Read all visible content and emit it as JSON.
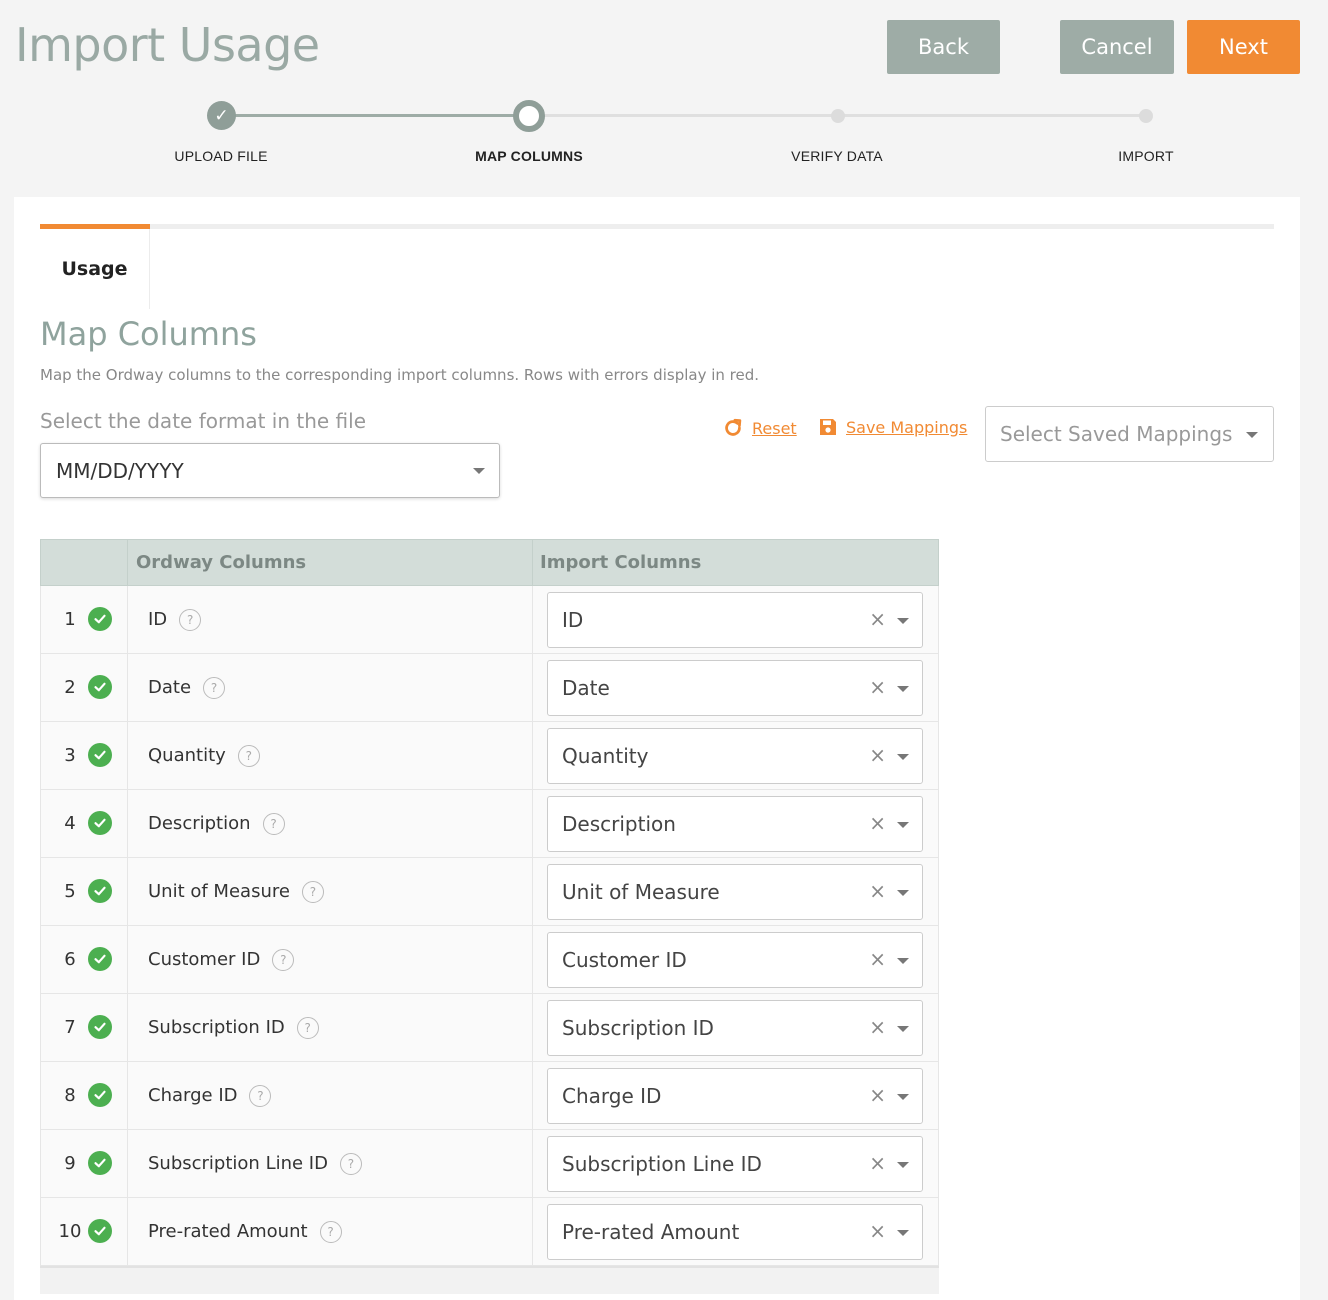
{
  "header": {
    "title": "Import Usage",
    "back_label": "Back",
    "cancel_label": "Cancel",
    "next_label": "Next"
  },
  "colors": {
    "accent": "#f18a33",
    "muted_button": "#9eaca6",
    "success": "#4caf50",
    "table_header": "#d3ddd9"
  },
  "stepper": {
    "steps": [
      {
        "label": "UPLOAD FILE",
        "state": "done"
      },
      {
        "label": "MAP COLUMNS",
        "state": "current"
      },
      {
        "label": "VERIFY DATA",
        "state": "todo"
      },
      {
        "label": "IMPORT",
        "state": "todo"
      }
    ]
  },
  "tabs": [
    {
      "label": "Usage",
      "active": true
    }
  ],
  "main": {
    "title": "Map Columns",
    "description": "Map the Ordway columns to the corresponding import columns. Rows with errors display in red.",
    "date_format_label": "Select the date format in the file",
    "date_format_value": "MM/DD/YYYY",
    "reset_label": "Reset",
    "save_mappings_label": "Save Mappings",
    "saved_mappings_placeholder": "Select Saved Mappings"
  },
  "table": {
    "headers": {
      "col1": "",
      "ordway": "Ordway Columns",
      "import": "Import Columns"
    },
    "rows": [
      {
        "num": "1",
        "ordway": "ID",
        "import": "ID"
      },
      {
        "num": "2",
        "ordway": "Date",
        "import": "Date"
      },
      {
        "num": "3",
        "ordway": "Quantity",
        "import": "Quantity"
      },
      {
        "num": "4",
        "ordway": "Description",
        "import": "Description"
      },
      {
        "num": "5",
        "ordway": "Unit of Measure",
        "import": "Unit of Measure"
      },
      {
        "num": "6",
        "ordway": "Customer ID",
        "import": "Customer ID"
      },
      {
        "num": "7",
        "ordway": "Subscription ID",
        "import": "Subscription ID"
      },
      {
        "num": "8",
        "ordway": "Charge ID",
        "import": "Charge ID"
      },
      {
        "num": "9",
        "ordway": "Subscription Line ID",
        "import": "Subscription Line ID"
      },
      {
        "num": "10",
        "ordway": "Pre-rated Amount",
        "import": "Pre-rated Amount"
      }
    ],
    "help_glyph": "?",
    "clear_glyph": "×",
    "row_status_icon": "check-circle-icon"
  }
}
